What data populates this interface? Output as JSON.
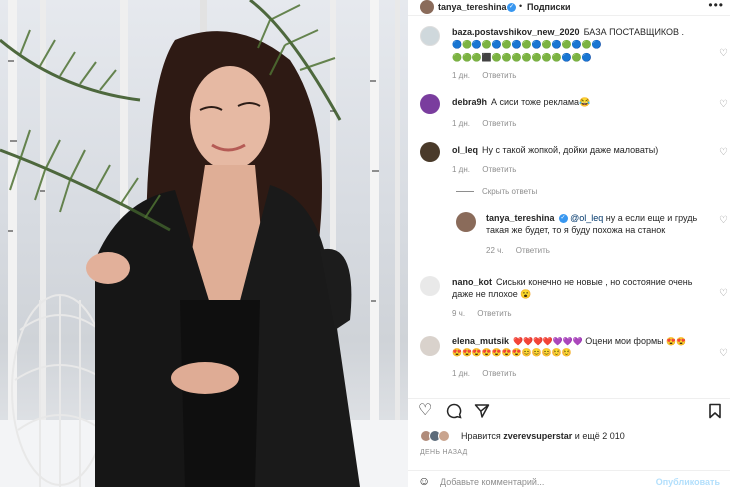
{
  "header": {
    "username": "tanya_tereshina",
    "follow_label": "Подписки",
    "more": "•••"
  },
  "comments": [
    {
      "username": "baza.postavshikov_new_2020",
      "text": "БАЗА ПОСТАВЩИКОВ .",
      "emoji_row1": "🔵🟢🔵🟢🔵🟢🔵🟢🔵🟢🔵🟢🔵🟢🔵",
      "emoji_row2": "🟢🟢🟢⬛🟢🟢🟢🟢🟢🟢🟢🔵🟢🔵",
      "time": "1 дн.",
      "reply": "Ответить"
    },
    {
      "username": "debra9h",
      "text": "А сиси тоже реклама😂",
      "time": "1 дн.",
      "reply": "Ответить"
    },
    {
      "username": "ol_leq",
      "text": "Ну с такой жопкой, дойки даже маловаты)",
      "time": "1 дн.",
      "reply": "Ответить"
    }
  ],
  "hide_replies": "Скрыть ответы",
  "reply": {
    "username": "tanya_tereshina",
    "mention": "@ol_leq",
    "text_line1": " ну а если еще и грудь",
    "text_line2": "такая же будет, то я буду похожа на станок",
    "time": "22 ч.",
    "reply": "Ответить"
  },
  "comment4": {
    "username": "nano_kot",
    "text_line1": "Сиськи конечно не новые , но состояние очень",
    "text_line2": "даже не плохое 😮",
    "time": "9 ч.",
    "reply": "Ответить"
  },
  "comment5": {
    "username": "elena_mutsik",
    "emoji_a": "❤️❤️❤️❤️💜💜💜",
    "text": "Оцени мои формы",
    "emoji_b": "😍😍",
    "emoji_row2": "😍😍😍😍😍😍😍😊😊😊☺️☺️",
    "time": "1 дн.",
    "reply": "Ответить"
  },
  "likes": {
    "prefix": "Нравится",
    "user": "zverevsuperstar",
    "suffix": "и ещё 2 010"
  },
  "date": "ДЕНЬ НАЗАД",
  "add_comment": {
    "placeholder": "Добавьте комментарий...",
    "publish": "Опубликовать"
  },
  "icons": [
    "heart-icon",
    "comment-icon",
    "share-icon",
    "bookmark-icon",
    "smile-icon",
    "verified-icon"
  ]
}
